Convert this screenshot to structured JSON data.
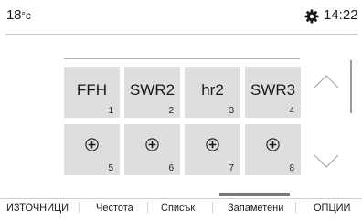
{
  "status": {
    "temperature_value": "18",
    "temperature_unit": "°c",
    "time": "14:22",
    "settings_icon": "gear-icon"
  },
  "presets": [
    {
      "name": "FFH",
      "number": "1"
    },
    {
      "name": "SWR2",
      "number": "2"
    },
    {
      "name": "hr2",
      "number": "3"
    },
    {
      "name": "SWR3",
      "number": "4"
    },
    {
      "name": "",
      "number": "5",
      "icon": "add-icon"
    },
    {
      "name": "",
      "number": "6",
      "icon": "add-icon"
    },
    {
      "name": "",
      "number": "7",
      "icon": "add-icon"
    },
    {
      "name": "",
      "number": "8",
      "icon": "add-icon"
    }
  ],
  "tabs": {
    "sources": "ИЗТОЧНИЦИ",
    "frequency": "Честота",
    "list": "Списък",
    "saved": "Запаметени",
    "options": "ОПЦИИ",
    "active": "saved"
  },
  "colors": {
    "tile_bg": "#dedede",
    "active_tab_indicator": "#7a7a7a"
  }
}
